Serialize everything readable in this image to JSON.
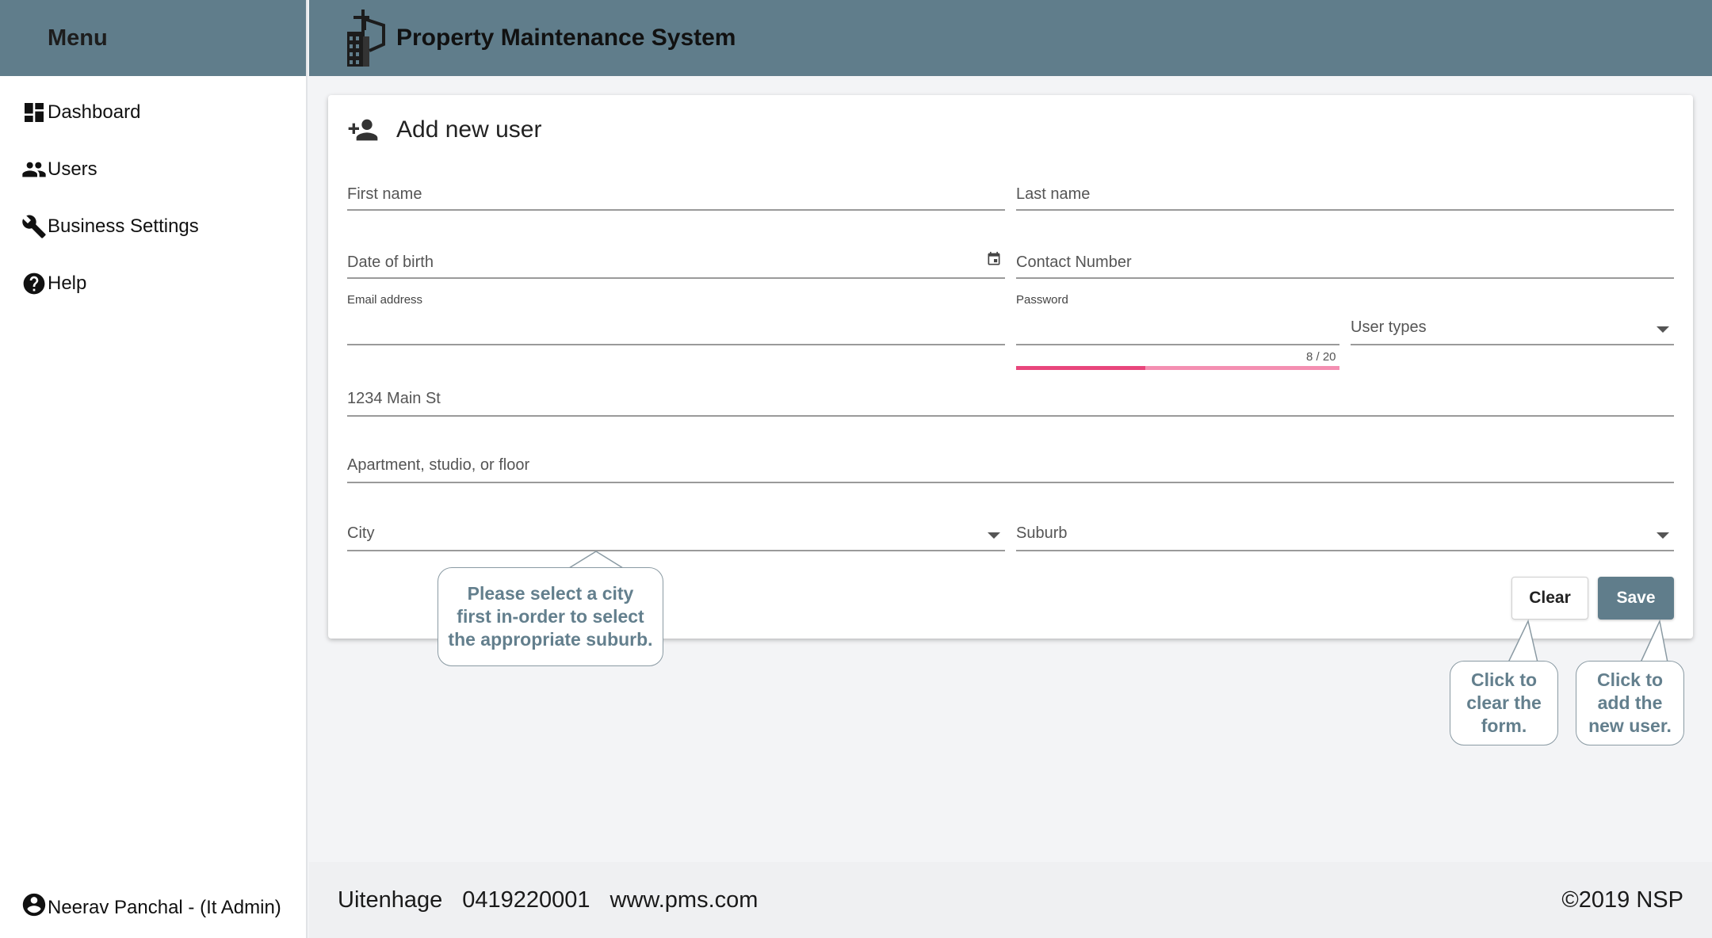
{
  "app": {
    "title": "Property Maintenance System"
  },
  "sidebar": {
    "menu_label": "Menu",
    "items": [
      {
        "label": "Dashboard",
        "icon": "dashboard-icon"
      },
      {
        "label": "Users",
        "icon": "users-icon"
      },
      {
        "label": "Business Settings",
        "icon": "wrench-icon"
      },
      {
        "label": "Help",
        "icon": "help-icon"
      }
    ],
    "user": "Neerav Panchal - (It Admin)"
  },
  "form": {
    "title": "Add new user",
    "first_name": "First name",
    "last_name": "Last name",
    "dob": "Date of birth",
    "contact": "Contact Number",
    "email": "Email address",
    "password": "Password",
    "password_counter": "8 / 20",
    "password_strength": 0.4,
    "user_types": "User types",
    "address1": "1234 Main St",
    "address2": "Apartment, studio, or floor",
    "city": "City",
    "suburb": "Suburb",
    "clear": "Clear",
    "save": "Save"
  },
  "tooltips": {
    "city": "Please select a city first in-order to select the appropriate suburb.",
    "clear": "Click to clear the form.",
    "save": "Click to add the new user."
  },
  "footer": {
    "city": "Uitenhage",
    "phone": "0419220001",
    "website": "www.pms.com",
    "copyright": "©2019 NSP"
  },
  "colors": {
    "primary": "#607d8b",
    "strength_fill": "#e8467c",
    "strength_track": "#f48fb1"
  }
}
